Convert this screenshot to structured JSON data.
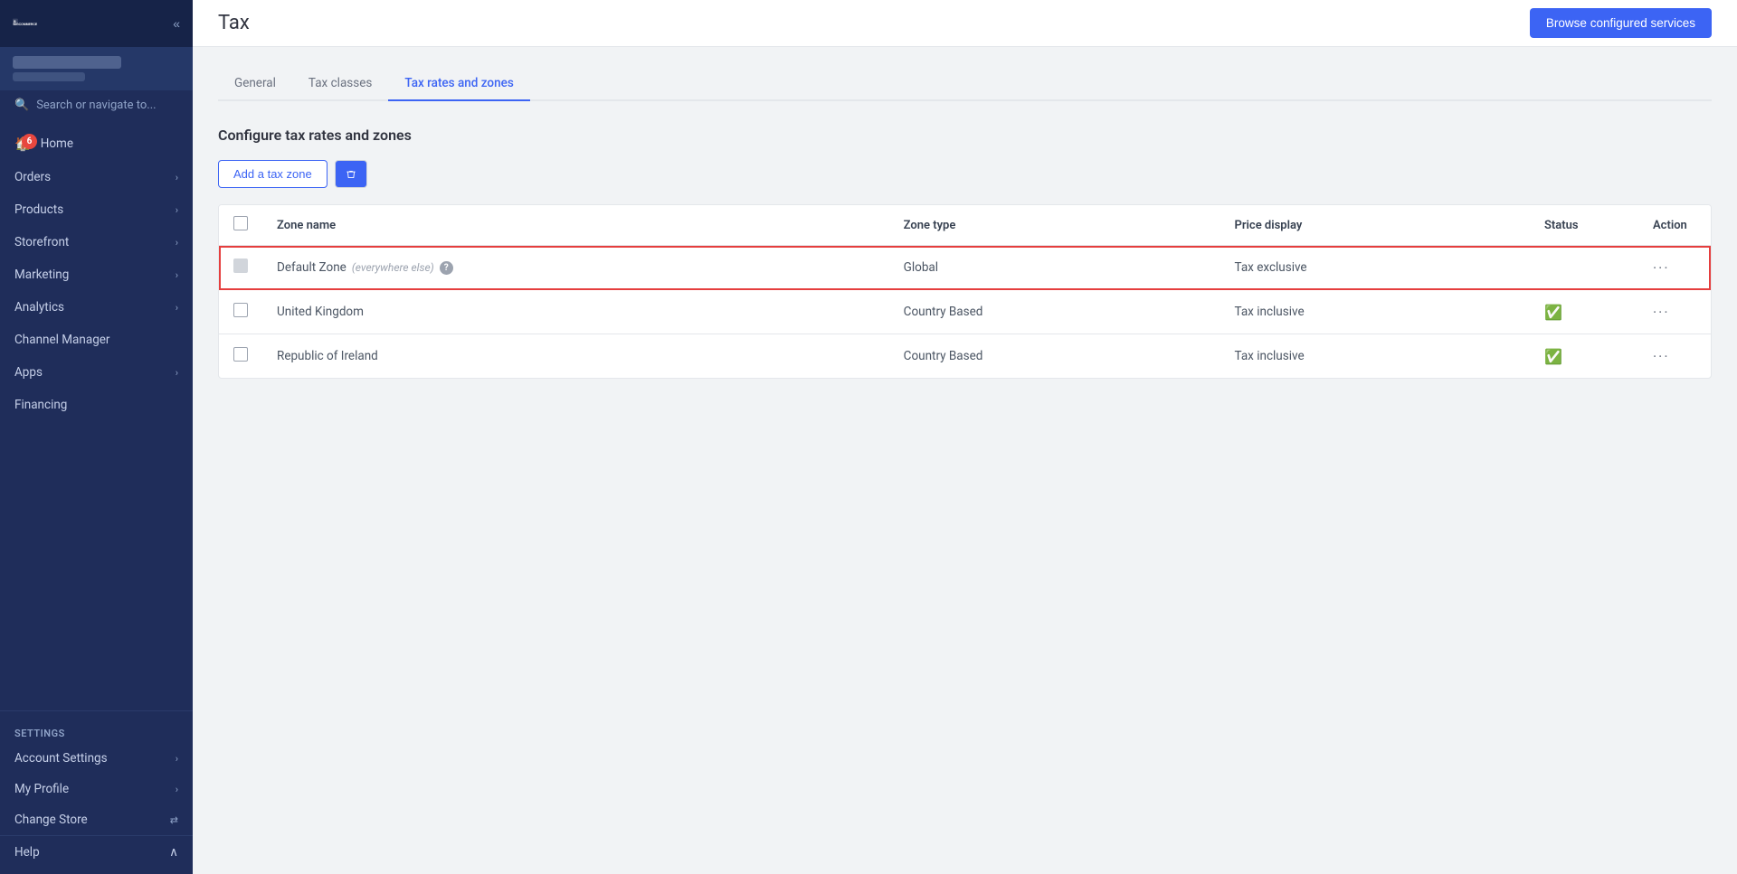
{
  "sidebar": {
    "logo_alt": "BigCommerce",
    "collapse_label": "«",
    "nav_items": [
      {
        "id": "home",
        "label": "Home",
        "icon": "🏠",
        "badge": "6",
        "has_chevron": false
      },
      {
        "id": "orders",
        "label": "Orders",
        "icon": "",
        "badge": "",
        "has_chevron": true
      },
      {
        "id": "products",
        "label": "Products",
        "icon": "",
        "badge": "",
        "has_chevron": true
      },
      {
        "id": "storefront",
        "label": "Storefront",
        "icon": "",
        "badge": "",
        "has_chevron": true
      },
      {
        "id": "marketing",
        "label": "Marketing",
        "icon": "",
        "badge": "",
        "has_chevron": true
      },
      {
        "id": "analytics",
        "label": "Analytics",
        "icon": "",
        "badge": "",
        "has_chevron": true
      },
      {
        "id": "channel-manager",
        "label": "Channel Manager",
        "icon": "",
        "badge": "",
        "has_chevron": false
      },
      {
        "id": "apps",
        "label": "Apps",
        "icon": "",
        "badge": "",
        "has_chevron": true
      },
      {
        "id": "financing",
        "label": "Financing",
        "icon": "",
        "badge": "",
        "has_chevron": false
      }
    ],
    "settings_label": "Settings",
    "footer_items": [
      {
        "id": "account-settings",
        "label": "Account Settings",
        "has_chevron": true
      },
      {
        "id": "my-profile",
        "label": "My Profile",
        "has_chevron": true
      },
      {
        "id": "change-store",
        "label": "Change Store",
        "has_arrow": true
      }
    ],
    "help_label": "Help",
    "search_placeholder": "Search or navigate to..."
  },
  "header": {
    "page_title": "Tax",
    "browse_button_label": "Browse configured services"
  },
  "tabs": [
    {
      "id": "general",
      "label": "General",
      "active": false
    },
    {
      "id": "tax-classes",
      "label": "Tax classes",
      "active": false
    },
    {
      "id": "tax-rates-zones",
      "label": "Tax rates and zones",
      "active": true
    }
  ],
  "content": {
    "section_title": "Configure tax rates and zones",
    "add_zone_label": "Add a tax zone",
    "delete_icon": "🗑",
    "table": {
      "columns": [
        "Zone name",
        "Zone type",
        "Price display",
        "Status",
        "Action"
      ],
      "rows": [
        {
          "id": "default-zone",
          "zone_name": "Default Zone",
          "zone_sub": "(everywhere else)",
          "zone_type": "Global",
          "price_display": "Tax exclusive",
          "status_active": false,
          "selected": true
        },
        {
          "id": "united-kingdom",
          "zone_name": "United Kingdom",
          "zone_sub": "",
          "zone_type": "Country Based",
          "price_display": "Tax inclusive",
          "status_active": true,
          "selected": false
        },
        {
          "id": "republic-of-ireland",
          "zone_name": "Republic of Ireland",
          "zone_sub": "",
          "zone_type": "Country Based",
          "price_display": "Tax inclusive",
          "status_active": true,
          "selected": false
        }
      ]
    }
  }
}
